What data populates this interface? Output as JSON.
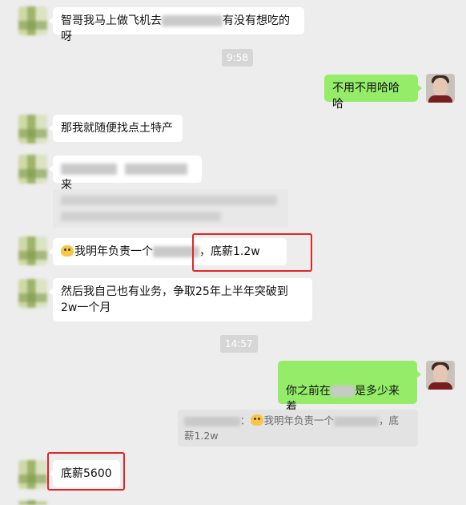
{
  "messages": {
    "m1": {
      "before": "智哥我马上做飞机去",
      "after": "有没有想吃的呀"
    },
    "t1": "9:58",
    "m2": "不用不用哈哈哈",
    "m3": "那我就随便找点土特产",
    "m4": {
      "after": "来"
    },
    "m5": {
      "before": "我明年负责一个",
      "after": "，底薪1.2w"
    },
    "m6": "然后我自己也有业务，争取25年上半年突破到2w一个月",
    "t2": "14:57",
    "m7": {
      "before": "你之前在",
      "after": "是多少来着"
    },
    "quote": {
      "mid": "：",
      "text": "我明年负责一个",
      "tail": "，底",
      "line2": "薪1.2w"
    },
    "m8": "底薪5600"
  },
  "colors": {
    "incoming": "#ffffff",
    "outgoing": "#95ec69",
    "highlight": "#e02727",
    "background": "#ededed"
  }
}
